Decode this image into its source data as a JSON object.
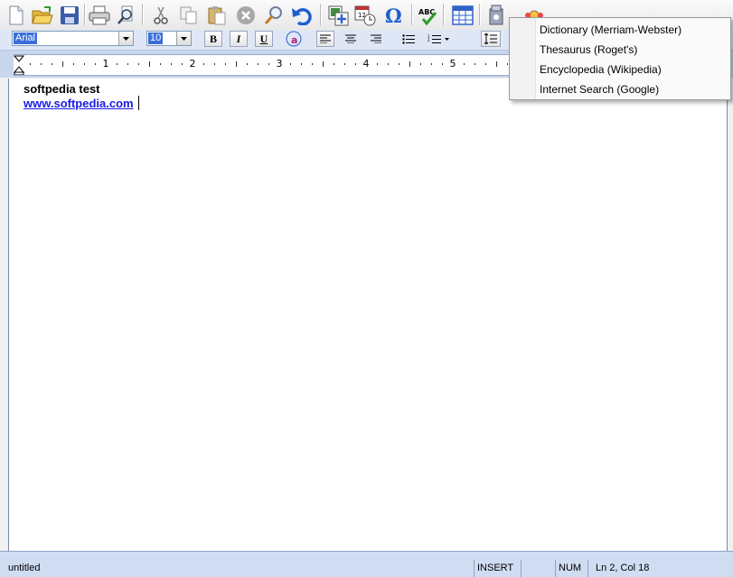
{
  "toolbar": {
    "buttons": [
      "new-document",
      "open-folder",
      "save",
      "print",
      "print-preview",
      "cut",
      "copy",
      "paste",
      "delete",
      "find",
      "undo",
      "insert-picture",
      "insert-date-time",
      "insert-symbol",
      "spell-check",
      "table",
      "research"
    ]
  },
  "format": {
    "font_name": "Arial",
    "font_size": "10",
    "bold_label": "B",
    "italic_label": "I",
    "underline_label": "U"
  },
  "ruler": {
    "numbers": [
      "1",
      "2",
      "3",
      "4",
      "5"
    ]
  },
  "document": {
    "line1": "softpedia test",
    "line2": "www.softpedia.com"
  },
  "research_menu": {
    "items": [
      "Dictionary (Merriam-Webster)",
      "Thesaurus (Roget's)",
      "Encyclopedia (Wikipedia)",
      "Internet Search (Google)"
    ]
  },
  "status": {
    "filename": "untitled",
    "mode": "INSERT",
    "num": "NUM",
    "position": "Ln 2, Col 18"
  },
  "colors": {
    "link": "#1a1ae6",
    "selection": "#3a6fd8",
    "accent": "#1f5fd0"
  }
}
